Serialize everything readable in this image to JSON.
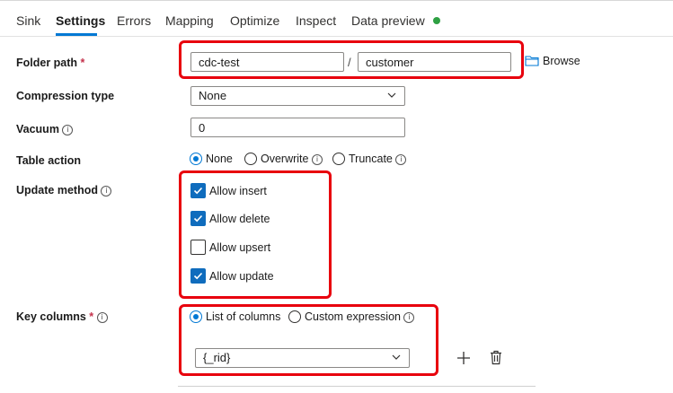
{
  "tabs": [
    {
      "label": "Sink"
    },
    {
      "label": "Settings"
    },
    {
      "label": "Errors"
    },
    {
      "label": "Mapping"
    },
    {
      "label": "Optimize"
    },
    {
      "label": "Inspect"
    },
    {
      "label": "Data preview"
    }
  ],
  "active_tab": "Settings",
  "data_preview_status_color": "#2ea043",
  "folder_path": {
    "label": "Folder path",
    "required_mark": "*",
    "container_value": "cdc-test",
    "separator": "/",
    "directory_value": "customer",
    "browse_label": "Browse"
  },
  "compression_type": {
    "label": "Compression type",
    "selected": "None"
  },
  "vacuum": {
    "label": "Vacuum",
    "info": "i",
    "value": "0"
  },
  "table_action": {
    "label": "Table action",
    "options": [
      {
        "label": "None",
        "selected": true
      },
      {
        "label": "Overwrite",
        "selected": false,
        "info": "i"
      },
      {
        "label": "Truncate",
        "selected": false,
        "info": "i"
      }
    ]
  },
  "update_method": {
    "label": "Update method",
    "info": "i",
    "options": [
      {
        "label": "Allow insert",
        "checked": true
      },
      {
        "label": "Allow delete",
        "checked": true
      },
      {
        "label": "Allow upsert",
        "checked": false
      },
      {
        "label": "Allow update",
        "checked": true
      }
    ]
  },
  "key_columns": {
    "label": "Key columns",
    "required_mark": "*",
    "info": "i",
    "mode_options": [
      {
        "label": "List of columns",
        "selected": true
      },
      {
        "label": "Custom expression",
        "selected": false,
        "info": "i"
      }
    ],
    "column_value": "{_rid}"
  },
  "colors": {
    "accent": "#0078d4",
    "checkbox_fill": "#0f6cbd",
    "highlight_box": "#e8000d",
    "required": "#c4314b"
  }
}
